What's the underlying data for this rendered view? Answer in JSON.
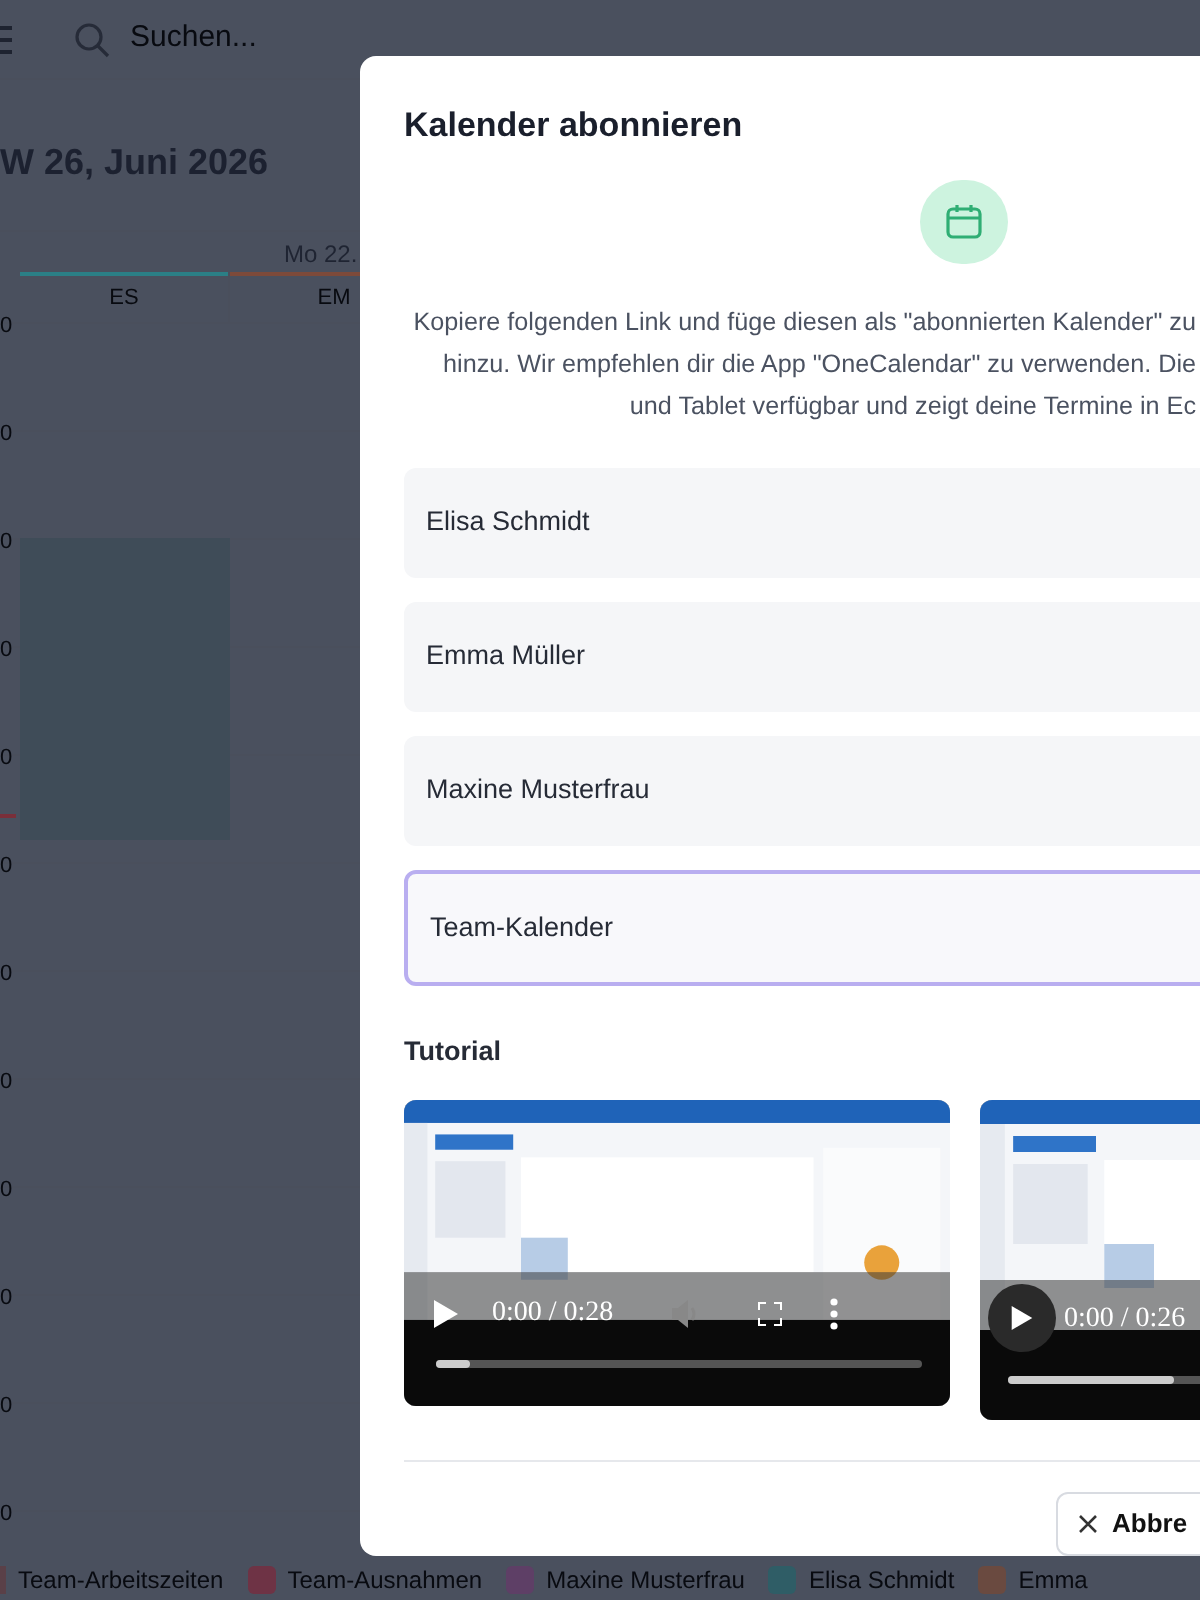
{
  "app_bar": {
    "search": {
      "placeholder": "Suchen..."
    }
  },
  "calendar": {
    "title": "W 26, Juni 2026",
    "day": "Mo 22.",
    "columns": [
      {
        "label": "ES",
        "color": "#2b7f86"
      },
      {
        "label": "EM",
        "color": "#7d4a3a"
      }
    ],
    "hours": [
      "0",
      "0",
      "0",
      "0",
      "0",
      "0",
      "0",
      "0",
      "0",
      "0",
      "0",
      "0"
    ]
  },
  "dialog": {
    "title": "Kalender abonnieren",
    "description_lines": [
      "Kopiere folgenden Link und füge diesen als \"abonnierten Kalender\" zu",
      "hinzu. Wir empfehlen dir die App \"OneCalendar\" zu verwenden. Die",
      "und Tablet verfügbar und zeigt deine Termine in Ec"
    ],
    "calendars": [
      {
        "name": "Elisa Schmidt",
        "selected": false
      },
      {
        "name": "Emma Müller",
        "selected": false
      },
      {
        "name": "Maxine Musterfrau",
        "selected": false
      },
      {
        "name": "Team-Kalender",
        "selected": true
      }
    ],
    "tutorial": {
      "heading": "Tutorial",
      "videos": [
        {
          "time": "0:00 / 0:28",
          "level": 0.07,
          "kind": "full"
        },
        {
          "time": "0:00 / 0:26",
          "level": 0.3,
          "kind": "partial"
        }
      ]
    },
    "cancel_button": "Abbre"
  },
  "legend": [
    {
      "label": "Team-Arbeitszeiten",
      "color": "#5a4048"
    },
    {
      "label": "Team-Ausnahmen",
      "color": "#6e3345"
    },
    {
      "label": "Maxine Musterfrau",
      "color": "#5e3f66"
    },
    {
      "label": "Elisa Schmidt",
      "color": "#2f5d66"
    },
    {
      "label": "Emma",
      "color": "#6a4a40"
    }
  ]
}
